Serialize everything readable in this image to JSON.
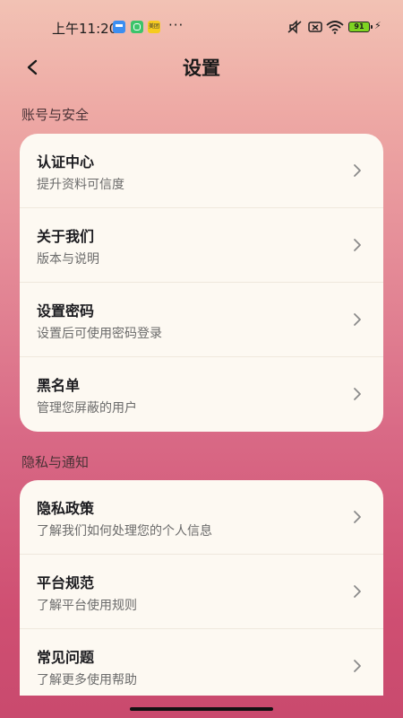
{
  "status_bar": {
    "time": "上午11:20",
    "dots": "···",
    "app3_text": "美团",
    "battery": "91"
  },
  "header": {
    "title": "设置"
  },
  "sections": [
    {
      "title": "账号与安全",
      "items": [
        {
          "title": "认证中心",
          "subtitle": "提升资料可信度"
        },
        {
          "title": "关于我们",
          "subtitle": "版本与说明"
        },
        {
          "title": "设置密码",
          "subtitle": "设置后可使用密码登录"
        },
        {
          "title": "黑名单",
          "subtitle": "管理您屏蔽的用户"
        }
      ]
    },
    {
      "title": "隐私与通知",
      "items": [
        {
          "title": "隐私政策",
          "subtitle": "了解我们如何处理您的个人信息"
        },
        {
          "title": "平台规范",
          "subtitle": "了解平台使用规则"
        },
        {
          "title": "常见问题",
          "subtitle": "了解更多使用帮助"
        }
      ]
    }
  ]
}
